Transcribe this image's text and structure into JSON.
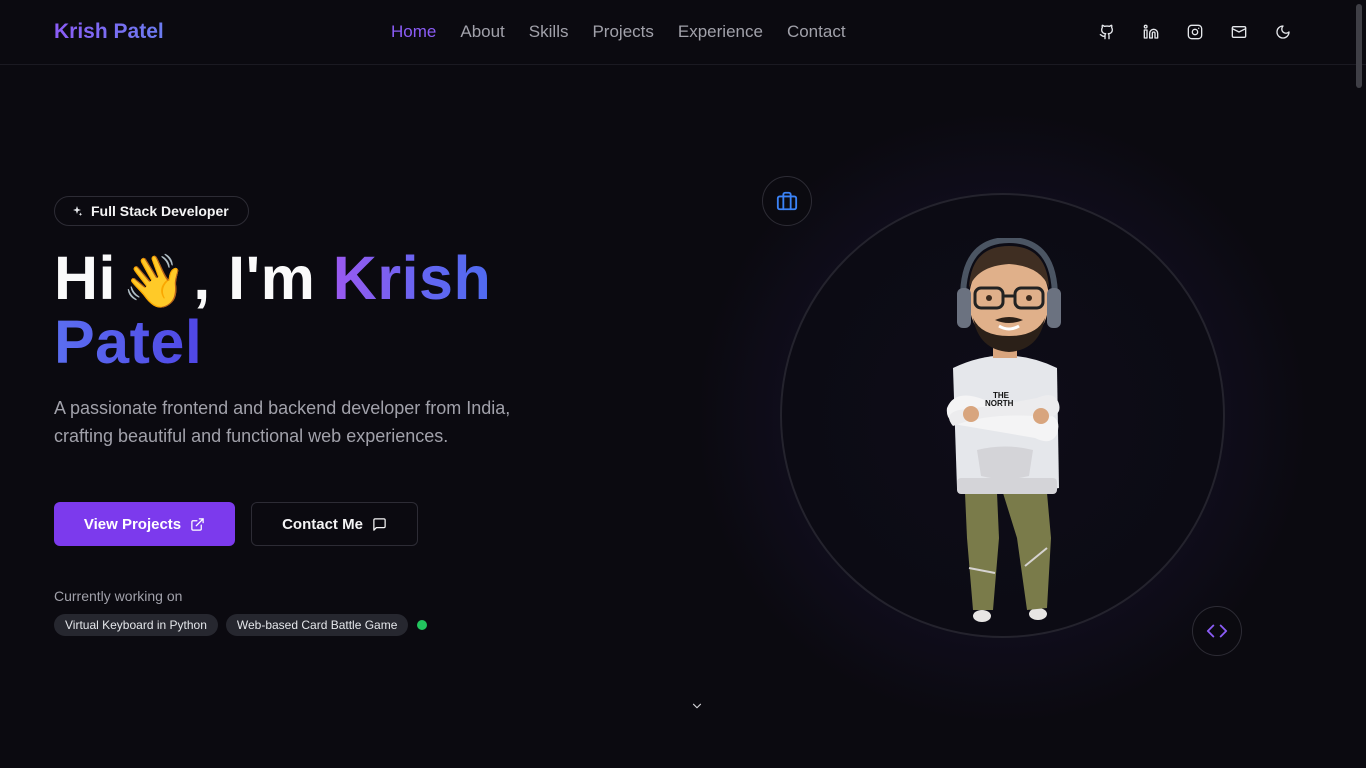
{
  "header": {
    "logo": "Krish Patel",
    "nav": [
      {
        "label": "Home",
        "active": true
      },
      {
        "label": "About",
        "active": false
      },
      {
        "label": "Skills",
        "active": false
      },
      {
        "label": "Projects",
        "active": false
      },
      {
        "label": "Experience",
        "active": false
      },
      {
        "label": "Contact",
        "active": false
      }
    ],
    "social_icons": [
      "github-icon",
      "linkedin-icon",
      "instagram-icon",
      "mail-icon",
      "moon-icon"
    ]
  },
  "hero": {
    "role_badge": "Full Stack Developer",
    "greeting": "Hi",
    "wave_emoji": "👋",
    "im": ", I'm",
    "first_name": "Krish",
    "last_name": "Patel",
    "description": "A passionate frontend and backend developer from India, crafting beautiful and functional web experiences.",
    "primary_button": "View Projects",
    "secondary_button": "Contact Me",
    "working_label": "Currently working on",
    "projects": [
      "Virtual Keyboard in Python",
      "Web-based Card Battle Game"
    ]
  },
  "colors": {
    "background": "#0b0a10",
    "accent_purple": "#7c3aed",
    "accent_blue": "#3b82f6",
    "status_green": "#22c55e"
  }
}
